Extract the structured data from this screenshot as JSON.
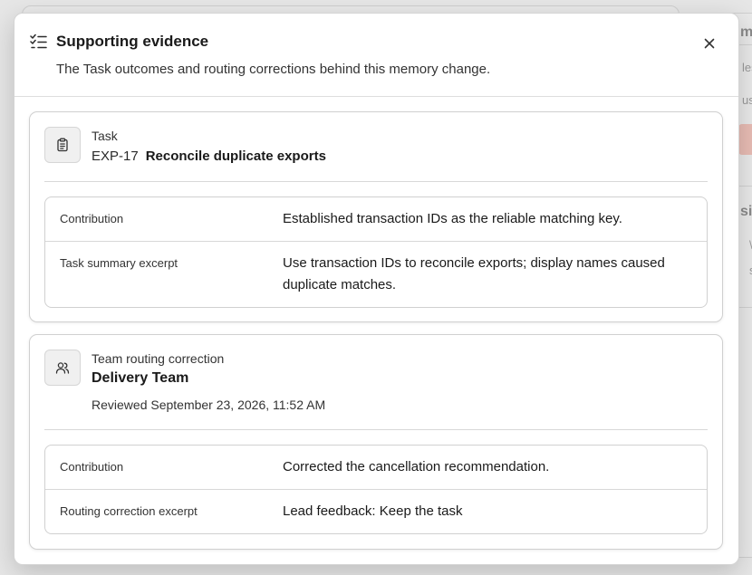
{
  "background": {
    "fragments": [
      "mo",
      "les",
      "us",
      "sic",
      "\\",
      "s"
    ]
  },
  "dialog": {
    "title": "Supporting evidence",
    "subtitle": "The Task outcomes and routing corrections behind this memory change.",
    "header_icon": "checklist-icon",
    "close_icon": "close-icon"
  },
  "evidence": [
    {
      "icon": "clipboard-icon",
      "label": "Task",
      "code": "EXP-17",
      "name": "Reconcile duplicate exports",
      "rows": [
        {
          "key": "Contribution",
          "value": "Established transaction IDs as the reliable matching key."
        },
        {
          "key": "Task summary excerpt",
          "value": "Use transaction IDs to reconcile exports; display names caused duplicate matches."
        }
      ]
    },
    {
      "icon": "users-icon",
      "label": "Team routing correction",
      "name": "Delivery Team",
      "meta": "Reviewed September 23, 2026, 11:52 AM",
      "rows": [
        {
          "key": "Contribution",
          "value": "Corrected the cancellation recommendation."
        },
        {
          "key": "Routing correction excerpt",
          "value": "Lead feedback: Keep the task"
        }
      ]
    }
  ],
  "colors": {
    "overlay": "#d9d9d9",
    "dialog_bg": "#ffffff",
    "border": "#d0d0d0",
    "icon_box": "#f0f0f0",
    "background_accent": "#e8bcb4"
  }
}
